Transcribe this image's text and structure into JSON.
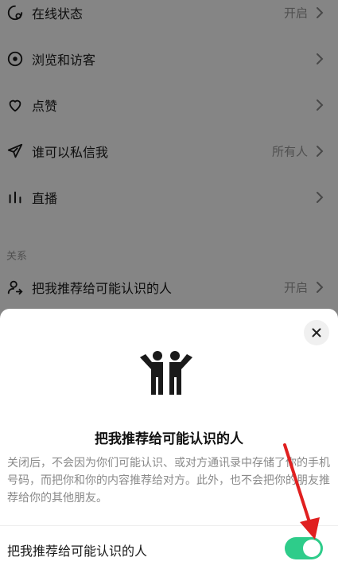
{
  "settings": {
    "rows": [
      {
        "label": "在线状态",
        "value": "开启",
        "icon": "online-status-icon"
      },
      {
        "label": "浏览和访客",
        "value": "",
        "icon": "eye-icon"
      },
      {
        "label": "点赞",
        "value": "",
        "icon": "heart-icon"
      },
      {
        "label": "谁可以私信我",
        "value": "所有人",
        "icon": "send-icon"
      },
      {
        "label": "直播",
        "value": "",
        "icon": "live-bars-icon"
      }
    ],
    "section_relation": "关系",
    "recommend_row": {
      "label": "把我推荐给可能认识的人",
      "value": "开启",
      "icon": "person-share-icon"
    }
  },
  "sheet": {
    "title": "把我推荐给可能认识的人",
    "description": "关闭后，不会因为你们可能认识、或对方通讯录中存储了你的手机号码，而把你和你的内容推荐给对方。此外，也不会把你的朋友推荐给你的其他朋友。",
    "toggle_label": "把我推荐给可能认识的人",
    "toggle_on": true
  },
  "colors": {
    "toggle_on": "#2ecc8a",
    "annotation_arrow": "#e02020",
    "overlay": "rgba(0,0,0,0.48)"
  }
}
